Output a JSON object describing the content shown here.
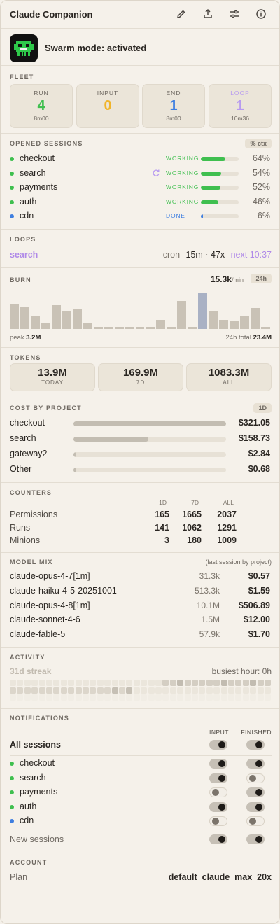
{
  "header": {
    "title": "Claude Companion",
    "icons": [
      "pencil-icon",
      "share-icon",
      "sliders-icon",
      "info-icon"
    ]
  },
  "swarm": {
    "text": "Swarm mode: activated"
  },
  "fleet": {
    "label": "FLEET",
    "cards": [
      {
        "label": "RUN",
        "value": "4",
        "sub": "8m00",
        "color": "#3fbf4f"
      },
      {
        "label": "INPUT",
        "value": "0",
        "sub": "",
        "color": "#f0b429"
      },
      {
        "label": "END",
        "value": "1",
        "sub": "8m00",
        "color": "#3f7fe0"
      },
      {
        "label": "LOOP",
        "value": "1",
        "sub": "10m36",
        "color": "#b79af0"
      }
    ]
  },
  "sessions": {
    "label": "OPENED SESSIONS",
    "pill": "% ctx",
    "items": [
      {
        "name": "checkout",
        "status": "WORKING",
        "pct": "64%",
        "ctx": 0.64,
        "dot": "#3fbf4f",
        "bar": "#3fbf4f"
      },
      {
        "name": "search",
        "status": "WORKING",
        "pct": "54%",
        "ctx": 0.54,
        "dot": "#3fbf4f",
        "bar": "#3fbf4f",
        "loop_icon": "loop-icon"
      },
      {
        "name": "payments",
        "status": "WORKING",
        "pct": "52%",
        "ctx": 0.52,
        "dot": "#3fbf4f",
        "bar": "#3fbf4f"
      },
      {
        "name": "auth",
        "status": "WORKING",
        "pct": "46%",
        "ctx": 0.46,
        "dot": "#3fbf4f",
        "bar": "#3fbf4f"
      },
      {
        "name": "cdn",
        "status": "DONE",
        "pct": "6%",
        "ctx": 0.06,
        "dot": "#3f7fe0",
        "bar": "#3f7fe0"
      }
    ]
  },
  "loops": {
    "label": "LOOPS",
    "name": "search",
    "cron_label": "cron",
    "schedule": "15m · 47x",
    "next": "next 10:37"
  },
  "burn": {
    "label": "BURN",
    "rate": "15.3k",
    "rate_unit": "/min",
    "pill": "24h",
    "peak_label": "peak",
    "peak": "3.2M",
    "total_label": "24h total",
    "total": "23.4M",
    "bars": [
      0.56,
      0.5,
      0.29,
      0.13,
      0.54,
      0.4,
      0.46,
      0.14,
      0.04,
      0.04,
      0.04,
      0.04,
      0.04,
      0.04,
      0.21,
      0.04,
      0.64,
      0.04,
      0.81,
      0.41,
      0.2,
      0.19,
      0.3,
      0.47,
      0.04
    ],
    "highlight_index": 18
  },
  "tokens": {
    "label": "TOKENS",
    "cards": [
      {
        "value": "13.9M",
        "label": "TODAY"
      },
      {
        "value": "169.9M",
        "label": "7D"
      },
      {
        "value": "1083.3M",
        "label": "ALL"
      }
    ]
  },
  "cost": {
    "label": "COST BY PROJECT",
    "pill": "1D",
    "items": [
      {
        "name": "checkout",
        "value": "$321.05",
        "share": 1.0
      },
      {
        "name": "search",
        "value": "$158.73",
        "share": 0.49
      },
      {
        "name": "gateway2",
        "value": "$2.84",
        "share": 0.01
      },
      {
        "name": "Other",
        "value": "$0.68",
        "share": 0.005
      }
    ]
  },
  "counters": {
    "label": "COUNTERS",
    "columns": [
      "1D",
      "7D",
      "ALL"
    ],
    "rows": [
      {
        "name": "Permissions",
        "values": [
          "165",
          "1665",
          "2037"
        ]
      },
      {
        "name": "Runs",
        "values": [
          "141",
          "1062",
          "1291"
        ]
      },
      {
        "name": "Minions",
        "values": [
          "3",
          "180",
          "1009"
        ]
      }
    ]
  },
  "model_mix": {
    "label": "MODEL MIX",
    "note": "(last session by project)",
    "items": [
      {
        "name": "claude-opus-4-7[1m]",
        "tokens": "31.3k",
        "cost": "$0.57"
      },
      {
        "name": "claude-haiku-4-5-20251001",
        "tokens": "513.3k",
        "cost": "$1.59"
      },
      {
        "name": "claude-opus-4-8[1m]",
        "tokens": "10.1M",
        "cost": "$506.89"
      },
      {
        "name": "claude-sonnet-4-6",
        "tokens": "1.5M",
        "cost": "$12.00"
      },
      {
        "name": "claude-fable-5",
        "tokens": "57.9k",
        "cost": "$1.70"
      }
    ]
  },
  "activity": {
    "label": "ACTIVITY",
    "streak": "31d streak",
    "busiest": "busiest hour: 0h"
  },
  "notifications": {
    "label": "NOTIFICATIONS",
    "columns": [
      "INPUT",
      "FINISHED"
    ],
    "all_label": "All sessions",
    "all": {
      "input": true,
      "finished": true
    },
    "items": [
      {
        "name": "checkout",
        "dot": "#3fbf4f",
        "input": true,
        "finished": true
      },
      {
        "name": "search",
        "dot": "#3fbf4f",
        "input": true,
        "finished": false
      },
      {
        "name": "payments",
        "dot": "#3fbf4f",
        "input": false,
        "finished": true
      },
      {
        "name": "auth",
        "dot": "#3fbf4f",
        "input": true,
        "finished": true
      },
      {
        "name": "cdn",
        "dot": "#3f7fe0",
        "input": false,
        "finished": false
      }
    ],
    "new_label": "New sessions",
    "new": {
      "input": true,
      "finished": true
    }
  },
  "account": {
    "label": "ACCOUNT",
    "plan_label": "Plan",
    "plan": "default_claude_max_20x"
  }
}
